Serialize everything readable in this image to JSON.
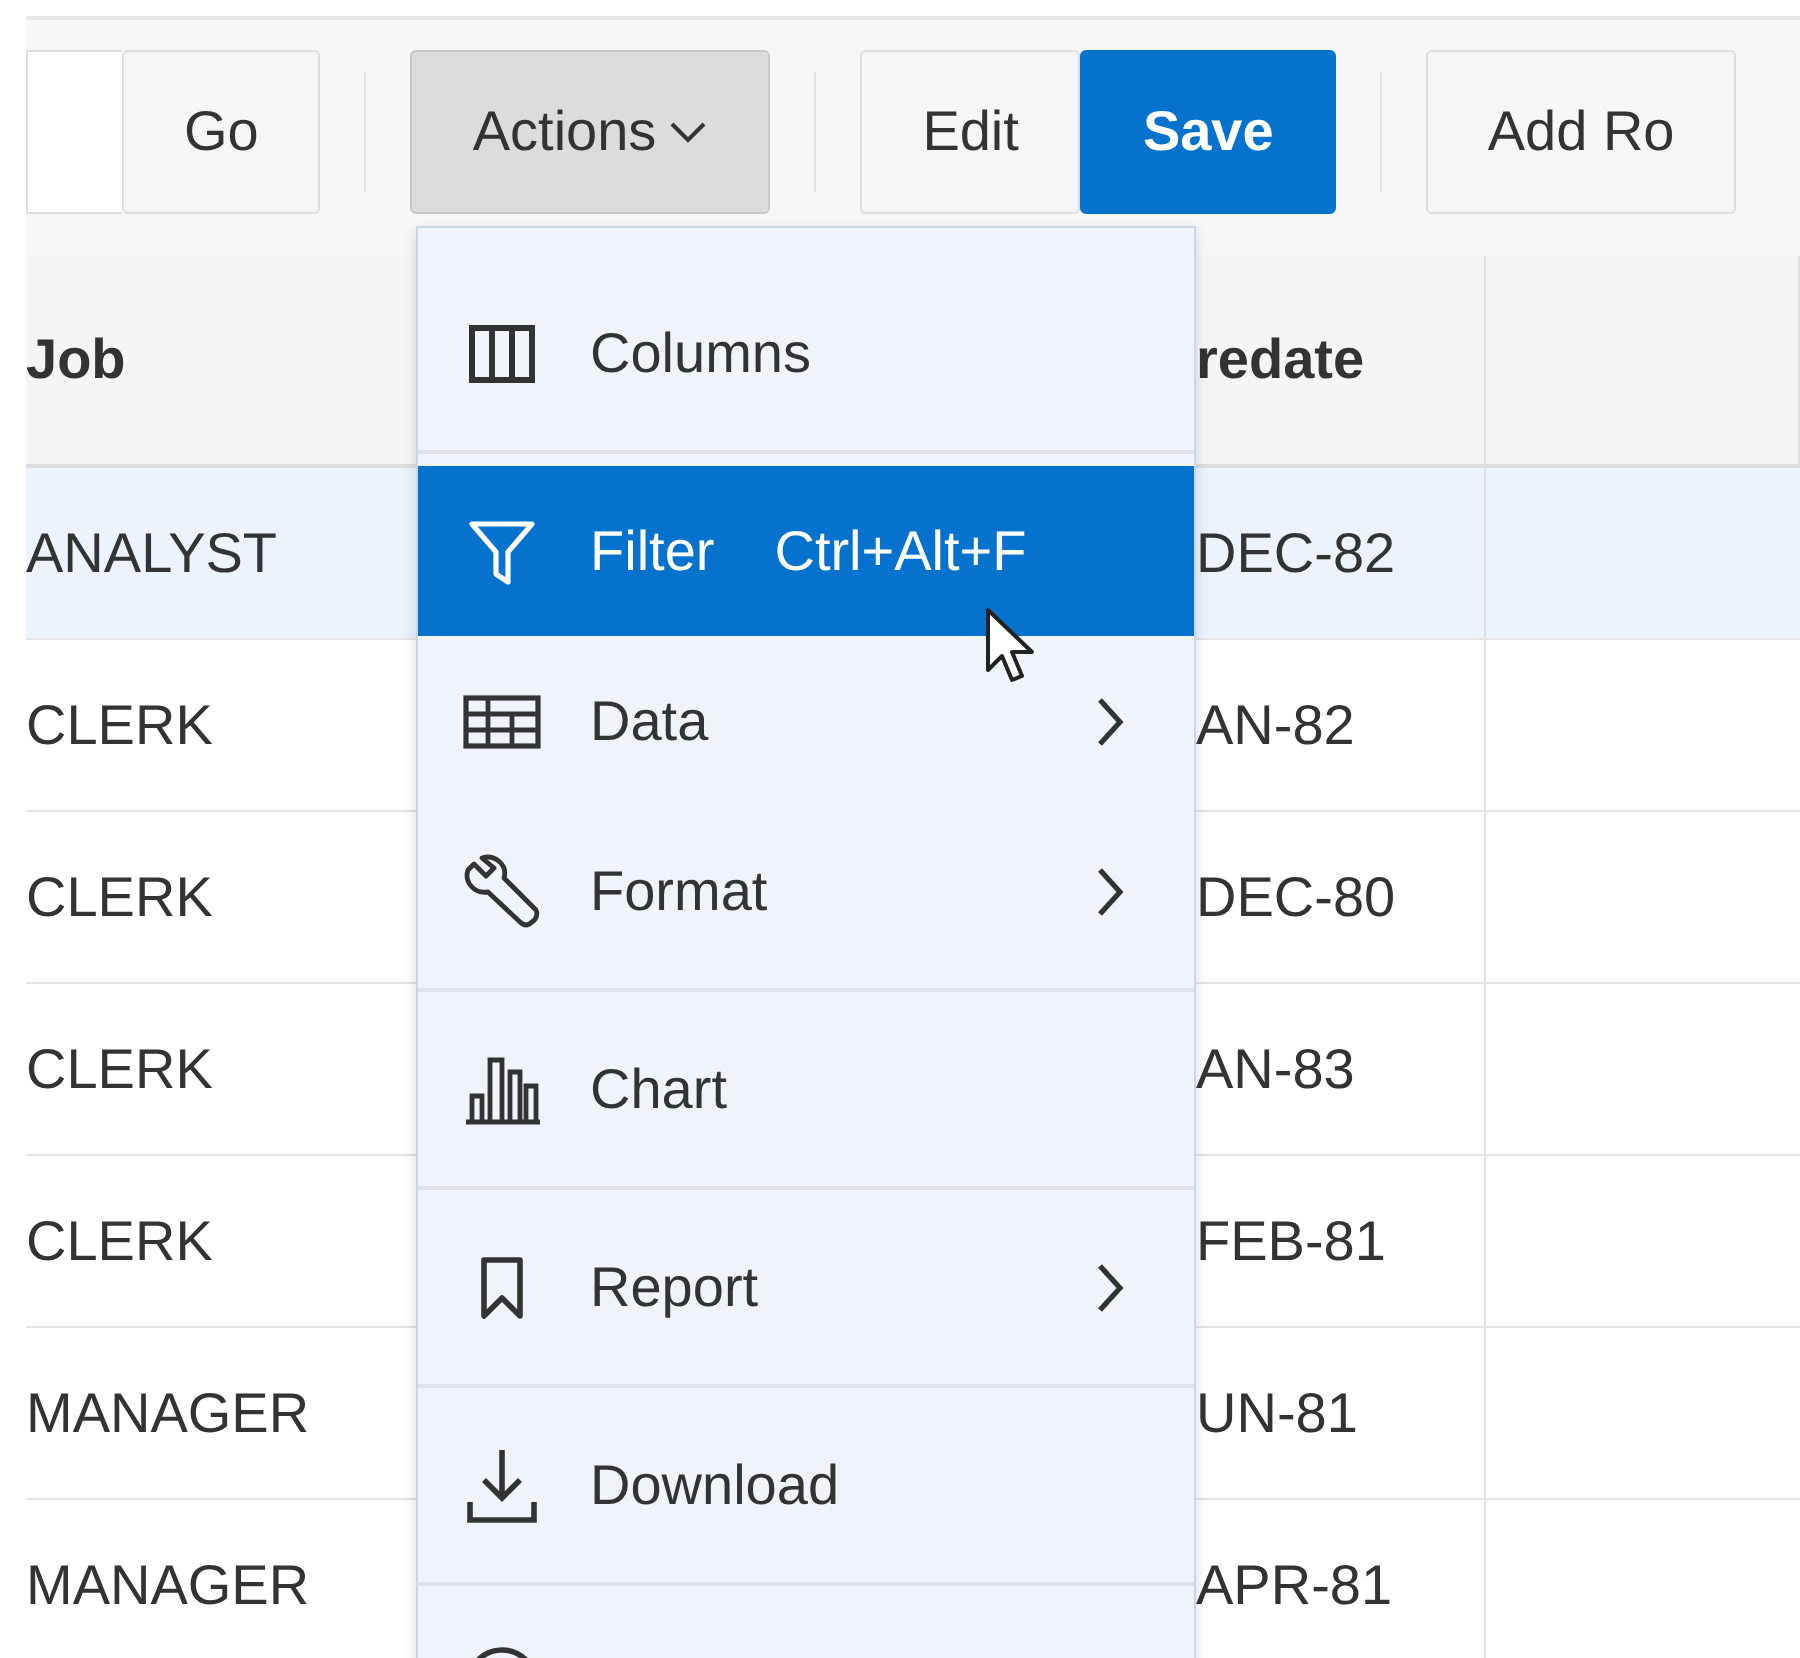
{
  "toolbar": {
    "buttons": [
      {
        "label": "Go",
        "kind": "default"
      },
      {
        "label": "Actions",
        "kind": "menu",
        "expanded": true
      },
      {
        "label": "Edit",
        "kind": "default"
      },
      {
        "label": "Save",
        "kind": "primary"
      },
      {
        "label": "Add Ro",
        "kind": "default"
      }
    ]
  },
  "table": {
    "columns": [
      "Job",
      "redate"
    ],
    "rows": [
      {
        "job": "ANALYST",
        "hiredate": "DEC-82",
        "selected": true
      },
      {
        "job": "CLERK",
        "hiredate": "AN-82",
        "selected": false
      },
      {
        "job": "CLERK",
        "hiredate": "DEC-80",
        "selected": false
      },
      {
        "job": "CLERK",
        "hiredate": "AN-83",
        "selected": false
      },
      {
        "job": "CLERK",
        "hiredate": "FEB-81",
        "selected": false
      },
      {
        "job": "MANAGER",
        "hiredate": "UN-81",
        "selected": false
      },
      {
        "job": "MANAGER",
        "hiredate": "APR-81",
        "selected": false
      }
    ]
  },
  "actions_menu": {
    "groups": [
      [
        {
          "kind": "columns",
          "label": "Columns",
          "selected": false,
          "submenu": false
        }
      ],
      [
        {
          "kind": "filter",
          "label": "Filter",
          "shortcut": "Ctrl+Alt+F",
          "selected": true,
          "submenu": false
        },
        {
          "kind": "data",
          "label": "Data",
          "selected": false,
          "submenu": true
        },
        {
          "kind": "format",
          "label": "Format",
          "selected": false,
          "submenu": true
        }
      ],
      [
        {
          "kind": "chart",
          "label": "Chart",
          "selected": false,
          "submenu": false
        }
      ],
      [
        {
          "kind": "report",
          "label": "Report",
          "selected": false,
          "submenu": true
        }
      ],
      [
        {
          "kind": "download",
          "label": "Download",
          "selected": false,
          "submenu": false
        }
      ],
      [
        {
          "kind": "circle",
          "selected": false
        }
      ]
    ]
  }
}
